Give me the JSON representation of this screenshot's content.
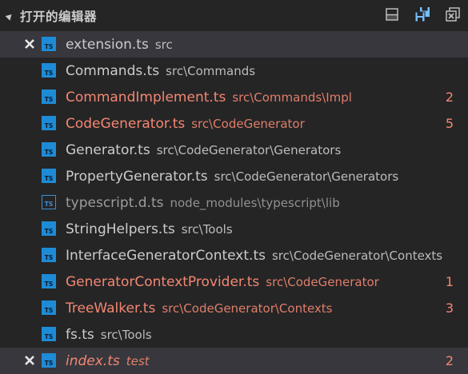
{
  "section": {
    "title": "打开的编辑器",
    "actions": [
      {
        "name": "toggle-layout-icon",
        "label": "Toggle Vertical/Horizontal Editor Layout"
      },
      {
        "name": "save-all-icon",
        "label": "Save All"
      },
      {
        "name": "close-all-icon",
        "label": "Close All Editors"
      }
    ]
  },
  "colors": {
    "background": "#252526",
    "dirty_row": "#37373d",
    "error": "#f48771",
    "ts_icon": "#1e8bd6",
    "text": "#cccccc"
  },
  "editors": [
    {
      "name": "extension.ts",
      "path": "src",
      "badge": "",
      "dirty": true,
      "error": false,
      "italic": false,
      "muted": false,
      "icon": "ts-file-icon"
    },
    {
      "name": "Commands.ts",
      "path": "src\\Commands",
      "badge": "",
      "dirty": false,
      "error": false,
      "italic": false,
      "muted": false,
      "icon": "ts-file-icon"
    },
    {
      "name": "CommandImplement.ts",
      "path": "src\\Commands\\Impl",
      "badge": "2",
      "dirty": false,
      "error": true,
      "italic": false,
      "muted": false,
      "icon": "ts-file-icon"
    },
    {
      "name": "CodeGenerator.ts",
      "path": "src\\CodeGenerator",
      "badge": "5",
      "dirty": false,
      "error": true,
      "italic": false,
      "muted": false,
      "icon": "ts-file-icon"
    },
    {
      "name": "Generator.ts",
      "path": "src\\CodeGenerator\\Generators",
      "badge": "",
      "dirty": false,
      "error": false,
      "italic": false,
      "muted": false,
      "icon": "ts-file-icon"
    },
    {
      "name": "PropertyGenerator.ts",
      "path": "src\\CodeGenerator\\Generators",
      "badge": "",
      "dirty": false,
      "error": false,
      "italic": false,
      "muted": false,
      "icon": "ts-file-icon"
    },
    {
      "name": "typescript.d.ts",
      "path": "node_modules\\typescript\\lib",
      "badge": "",
      "dirty": false,
      "error": false,
      "italic": false,
      "muted": true,
      "icon": "ts-definition-file-icon"
    },
    {
      "name": "StringHelpers.ts",
      "path": "src\\Tools",
      "badge": "",
      "dirty": false,
      "error": false,
      "italic": false,
      "muted": false,
      "icon": "ts-file-icon"
    },
    {
      "name": "InterfaceGeneratorContext.ts",
      "path": "src\\CodeGenerator\\Contexts",
      "badge": "",
      "dirty": false,
      "error": false,
      "italic": false,
      "muted": false,
      "icon": "ts-file-icon"
    },
    {
      "name": "GeneratorContextProvider.ts",
      "path": "src\\CodeGenerator",
      "badge": "1",
      "dirty": false,
      "error": true,
      "italic": false,
      "muted": false,
      "icon": "ts-file-icon"
    },
    {
      "name": "TreeWalker.ts",
      "path": "src\\CodeGenerator\\Contexts",
      "badge": "3",
      "dirty": false,
      "error": true,
      "italic": false,
      "muted": false,
      "icon": "ts-file-icon"
    },
    {
      "name": "fs.ts",
      "path": "src\\Tools",
      "badge": "",
      "dirty": false,
      "error": false,
      "italic": false,
      "muted": false,
      "icon": "ts-file-icon"
    },
    {
      "name": "index.ts",
      "path": "test",
      "badge": "2",
      "dirty": true,
      "error": true,
      "italic": true,
      "muted": false,
      "icon": "ts-file-icon"
    }
  ],
  "icon_text": "TS"
}
